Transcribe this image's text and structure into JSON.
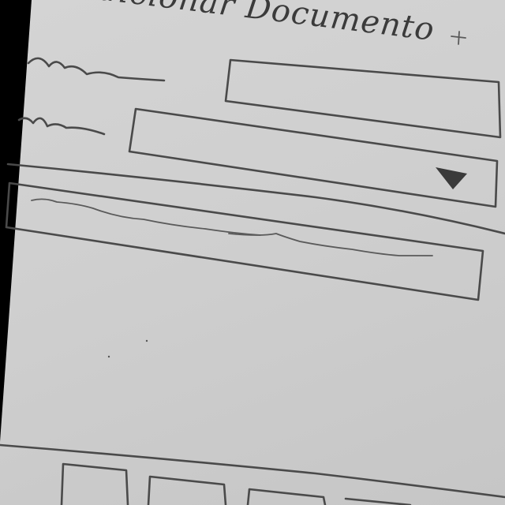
{
  "form": {
    "title": "Adicionar Documento"
  },
  "icons": {
    "dropdown": "triangle-down-icon"
  }
}
